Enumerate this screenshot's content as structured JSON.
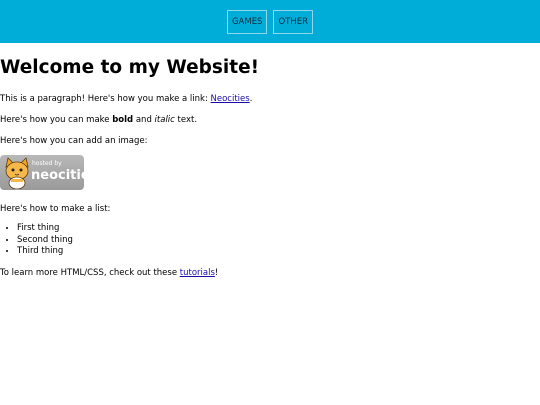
{
  "nav": {
    "games_label": "GAMES",
    "other_label": "OTHER"
  },
  "main": {
    "heading": "Welcome to my Website!",
    "para_link_before": "This is a paragraph! Here's how you make a link: ",
    "para_link_text": "Neocities",
    "para_link_after": ".",
    "bold_before": "Here's how you can make ",
    "bold_word": "bold",
    "bold_middle": " and ",
    "italic_word": "italic",
    "bold_after": " text.",
    "image_intro": "Here's how you can add an image:",
    "badge_small": "hosted by",
    "badge_big": "neocities",
    "list_intro": "Here's how to make a list:",
    "list_items": [
      "First thing",
      "Second thing",
      "Third thing"
    ],
    "learn_before": "To learn more HTML/CSS, check out these ",
    "learn_link": "tutorials",
    "learn_after": "!"
  }
}
